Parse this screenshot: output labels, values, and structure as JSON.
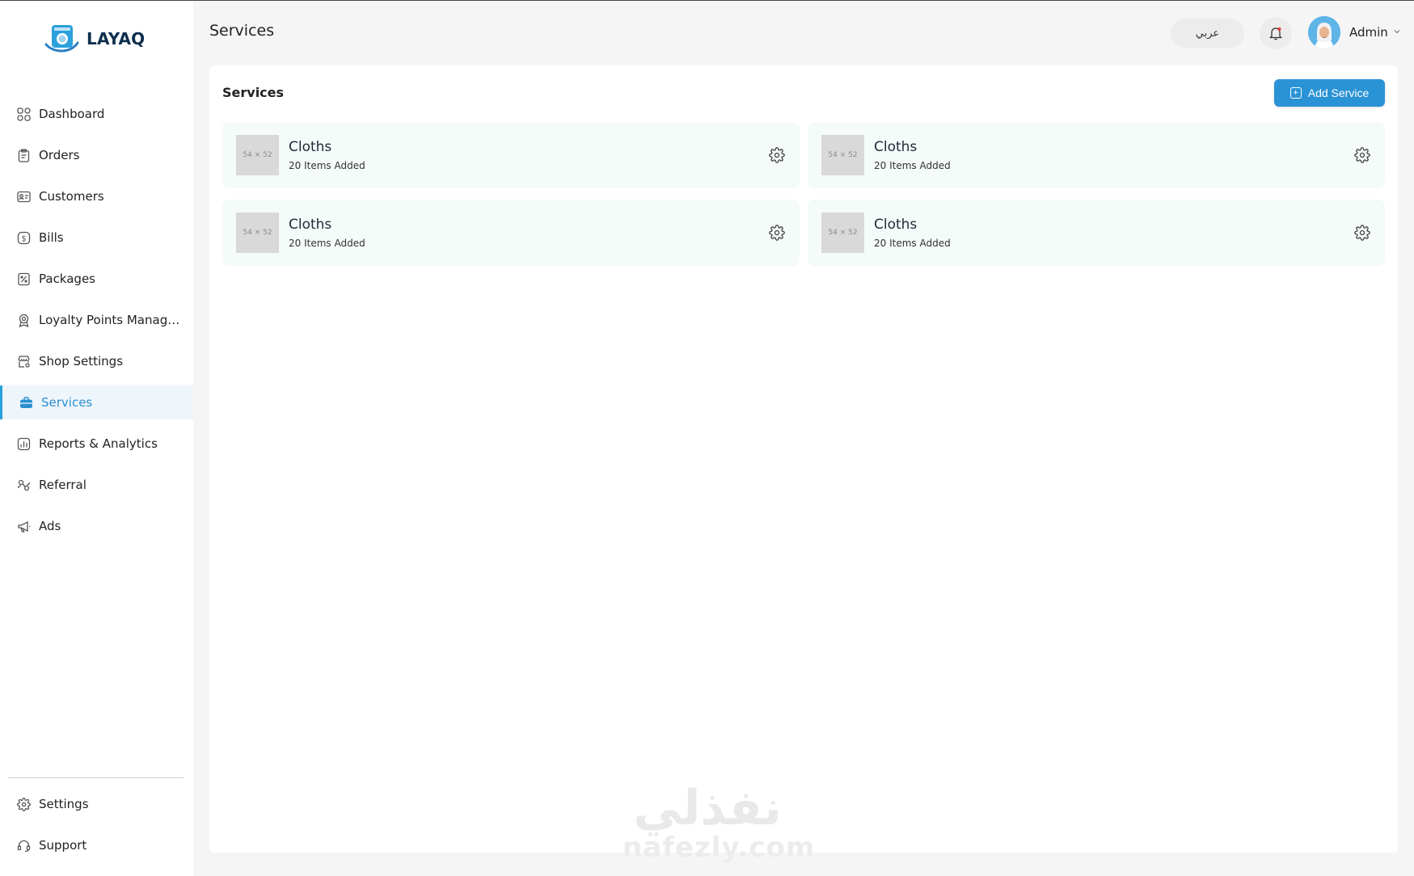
{
  "app": {
    "logo_text": "LAYAQ",
    "accent_color": "#2a93d5"
  },
  "sidebar": {
    "items": [
      {
        "label": "Dashboard",
        "icon": "grid-icon"
      },
      {
        "label": "Orders",
        "icon": "clipboard-icon"
      },
      {
        "label": "Customers",
        "icon": "id-card-icon"
      },
      {
        "label": "Bills",
        "icon": "dollar-icon"
      },
      {
        "label": "Packages",
        "icon": "percent-tag-icon"
      },
      {
        "label": "Loyalty Points Manage...",
        "icon": "award-icon"
      },
      {
        "label": "Shop Settings",
        "icon": "shop-settings-icon"
      },
      {
        "label": "Services",
        "icon": "briefcase-icon",
        "active": true
      },
      {
        "label": "Reports & Analytics",
        "icon": "chart-icon"
      },
      {
        "label": "Referral",
        "icon": "referral-icon"
      },
      {
        "label": "Ads",
        "icon": "megaphone-icon"
      }
    ],
    "bottom_items": [
      {
        "label": "Settings",
        "icon": "gear-icon"
      },
      {
        "label": "Support",
        "icon": "headset-icon"
      }
    ]
  },
  "header": {
    "page_title": "Services",
    "language_button": "عربي",
    "user_name": "Admin"
  },
  "main": {
    "section_title": "Services",
    "add_button_label": "Add Service",
    "services": [
      {
        "name": "Cloths",
        "count_text": "20 Items Added",
        "thumb_text": "54 × 52"
      },
      {
        "name": "Cloths",
        "count_text": "20 Items Added",
        "thumb_text": "54 × 52"
      },
      {
        "name": "Cloths",
        "count_text": "20 Items Added",
        "thumb_text": "54 × 52"
      },
      {
        "name": "Cloths",
        "count_text": "20 Items Added",
        "thumb_text": "54 × 52"
      }
    ]
  },
  "watermark": {
    "arabic": "نفذلي",
    "latin": "nafezly.com"
  }
}
